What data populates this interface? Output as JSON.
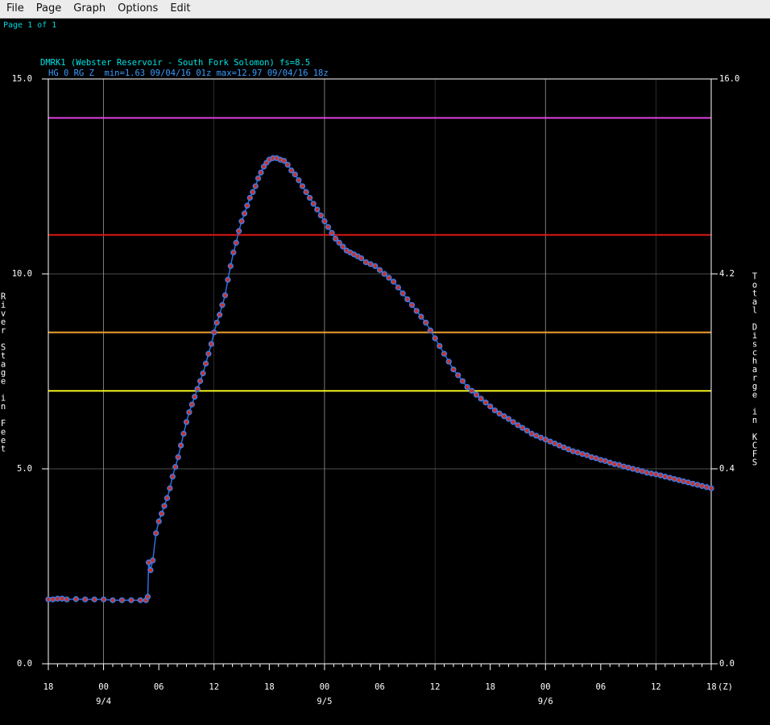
{
  "menu": {
    "items": [
      "File",
      "Page",
      "Graph",
      "Options",
      "Edit"
    ]
  },
  "page_indicator": "Page 1 of 1",
  "colors": {
    "background": "#000000",
    "grid": "#9a9a9a",
    "axis_text": "#ffffff",
    "title_text": "#00e5e5",
    "subtitle_text": "#3a9cff",
    "series_line": "#2f6fdc",
    "series_marker_fill": "#c8322c",
    "series_marker_stroke": "#3a7ff0"
  },
  "chart_data": {
    "type": "line",
    "title": "DMRK1 (Webster Reservoir - South Fork Solomon) fs=8.5",
    "subtitle": "HG 0 RG Z  min=1.63 09/04/16 01z max=12.97 09/04/16 18z",
    "ylabel": "River Stage in Feet",
    "y2label": "Total Discharge in KCFS",
    "ylim": [
      0,
      15
    ],
    "yticks": [
      "0.0",
      "5.0",
      "10.0",
      "15.0"
    ],
    "y2ticks": [
      "0.0",
      "0.4",
      "4.2",
      "16.0"
    ],
    "xlim": [
      0,
      72
    ],
    "x_unit": "hours after 09/03 18Z",
    "xticks": [
      {
        "x": 0,
        "label": "18",
        "date": ""
      },
      {
        "x": 6,
        "label": "00",
        "date": "9/4"
      },
      {
        "x": 12,
        "label": "06",
        "date": ""
      },
      {
        "x": 18,
        "label": "12",
        "date": ""
      },
      {
        "x": 24,
        "label": "18",
        "date": ""
      },
      {
        "x": 30,
        "label": "00",
        "date": "9/5"
      },
      {
        "x": 36,
        "label": "06",
        "date": ""
      },
      {
        "x": 42,
        "label": "12",
        "date": ""
      },
      {
        "x": 48,
        "label": "18",
        "date": ""
      },
      {
        "x": 54,
        "label": "00",
        "date": "9/6"
      },
      {
        "x": 60,
        "label": "06",
        "date": ""
      },
      {
        "x": 66,
        "label": "12",
        "date": ""
      },
      {
        "x": 72,
        "label": "18",
        "date": ""
      }
    ],
    "x_suffix": "(Z)",
    "grid": true,
    "thresholds": [
      {
        "value": 14.0,
        "color": "#e040e0"
      },
      {
        "value": 11.0,
        "color": "#e01818"
      },
      {
        "value": 8.5,
        "color": "#f0a030"
      },
      {
        "value": 7.0,
        "color": "#f0f020"
      }
    ],
    "series": [
      {
        "points": [
          [
            0,
            1.65
          ],
          [
            0.5,
            1.65
          ],
          [
            1,
            1.67
          ],
          [
            1.5,
            1.67
          ],
          [
            2,
            1.65
          ],
          [
            3,
            1.66
          ],
          [
            4,
            1.65
          ],
          [
            5,
            1.65
          ],
          [
            6,
            1.65
          ],
          [
            7,
            1.63
          ],
          [
            8,
            1.63
          ],
          [
            9,
            1.63
          ],
          [
            10,
            1.63
          ],
          [
            10.6,
            1.63
          ],
          [
            10.8,
            1.72
          ],
          [
            10.9,
            2.6
          ],
          [
            11.1,
            2.4
          ],
          [
            11.35,
            2.65
          ],
          [
            11.7,
            3.35
          ],
          [
            12.0,
            3.65
          ],
          [
            12.3,
            3.85
          ],
          [
            12.6,
            4.05
          ],
          [
            12.9,
            4.25
          ],
          [
            13.2,
            4.5
          ],
          [
            13.5,
            4.8
          ],
          [
            13.8,
            5.05
          ],
          [
            14.1,
            5.3
          ],
          [
            14.4,
            5.6
          ],
          [
            14.7,
            5.9
          ],
          [
            15.0,
            6.2
          ],
          [
            15.3,
            6.45
          ],
          [
            15.6,
            6.65
          ],
          [
            15.9,
            6.85
          ],
          [
            16.2,
            7.05
          ],
          [
            16.5,
            7.25
          ],
          [
            16.8,
            7.45
          ],
          [
            17.1,
            7.7
          ],
          [
            17.4,
            7.95
          ],
          [
            17.7,
            8.2
          ],
          [
            18.0,
            8.5
          ],
          [
            18.3,
            8.75
          ],
          [
            18.6,
            8.95
          ],
          [
            18.9,
            9.2
          ],
          [
            19.2,
            9.45
          ],
          [
            19.5,
            9.85
          ],
          [
            19.8,
            10.2
          ],
          [
            20.1,
            10.55
          ],
          [
            20.4,
            10.8
          ],
          [
            20.7,
            11.1
          ],
          [
            21.0,
            11.35
          ],
          [
            21.3,
            11.55
          ],
          [
            21.6,
            11.75
          ],
          [
            21.9,
            11.95
          ],
          [
            22.2,
            12.1
          ],
          [
            22.5,
            12.25
          ],
          [
            22.8,
            12.45
          ],
          [
            23.1,
            12.6
          ],
          [
            23.4,
            12.75
          ],
          [
            23.7,
            12.85
          ],
          [
            24.0,
            12.93
          ],
          [
            24.4,
            12.97
          ],
          [
            24.8,
            12.97
          ],
          [
            25.2,
            12.93
          ],
          [
            25.6,
            12.9
          ],
          [
            26.0,
            12.8
          ],
          [
            26.4,
            12.65
          ],
          [
            26.8,
            12.55
          ],
          [
            27.2,
            12.4
          ],
          [
            27.6,
            12.25
          ],
          [
            28.0,
            12.1
          ],
          [
            28.4,
            11.95
          ],
          [
            28.8,
            11.8
          ],
          [
            29.2,
            11.65
          ],
          [
            29.6,
            11.5
          ],
          [
            30.0,
            11.35
          ],
          [
            30.4,
            11.2
          ],
          [
            30.8,
            11.05
          ],
          [
            31.2,
            10.9
          ],
          [
            31.6,
            10.8
          ],
          [
            32.0,
            10.7
          ],
          [
            32.4,
            10.6
          ],
          [
            32.8,
            10.55
          ],
          [
            33.2,
            10.5
          ],
          [
            33.6,
            10.45
          ],
          [
            34.0,
            10.4
          ],
          [
            34.5,
            10.3
          ],
          [
            35.0,
            10.25
          ],
          [
            35.5,
            10.2
          ],
          [
            36.0,
            10.1
          ],
          [
            36.5,
            10.0
          ],
          [
            37.0,
            9.9
          ],
          [
            37.5,
            9.8
          ],
          [
            38.0,
            9.65
          ],
          [
            38.5,
            9.5
          ],
          [
            39.0,
            9.35
          ],
          [
            39.5,
            9.2
          ],
          [
            40.0,
            9.05
          ],
          [
            40.5,
            8.9
          ],
          [
            41.0,
            8.75
          ],
          [
            41.5,
            8.55
          ],
          [
            42.0,
            8.35
          ],
          [
            42.5,
            8.15
          ],
          [
            43.0,
            7.95
          ],
          [
            43.5,
            7.75
          ],
          [
            44.0,
            7.55
          ],
          [
            44.5,
            7.4
          ],
          [
            45.0,
            7.25
          ],
          [
            45.5,
            7.1
          ],
          [
            46.0,
            7.0
          ],
          [
            46.5,
            6.9
          ],
          [
            47.0,
            6.8
          ],
          [
            47.5,
            6.7
          ],
          [
            48.0,
            6.6
          ],
          [
            48.5,
            6.5
          ],
          [
            49.0,
            6.42
          ],
          [
            49.5,
            6.35
          ],
          [
            50.0,
            6.28
          ],
          [
            50.5,
            6.2
          ],
          [
            51.0,
            6.12
          ],
          [
            51.5,
            6.05
          ],
          [
            52.0,
            5.98
          ],
          [
            52.5,
            5.9
          ],
          [
            53.0,
            5.85
          ],
          [
            53.5,
            5.8
          ],
          [
            54.0,
            5.75
          ],
          [
            54.5,
            5.7
          ],
          [
            55.0,
            5.65
          ],
          [
            55.5,
            5.6
          ],
          [
            56.0,
            5.55
          ],
          [
            56.5,
            5.5
          ],
          [
            57.0,
            5.45
          ],
          [
            57.5,
            5.42
          ],
          [
            58.0,
            5.38
          ],
          [
            58.5,
            5.35
          ],
          [
            59.0,
            5.3
          ],
          [
            59.5,
            5.27
          ],
          [
            60.0,
            5.23
          ],
          [
            60.5,
            5.2
          ],
          [
            61.0,
            5.16
          ],
          [
            61.5,
            5.12
          ],
          [
            62.0,
            5.1
          ],
          [
            62.5,
            5.06
          ],
          [
            63.0,
            5.03
          ],
          [
            63.5,
            5.0
          ],
          [
            64.0,
            4.97
          ],
          [
            64.5,
            4.94
          ],
          [
            65.0,
            4.9
          ],
          [
            65.5,
            4.88
          ],
          [
            66.0,
            4.86
          ],
          [
            66.5,
            4.83
          ],
          [
            67.0,
            4.8
          ],
          [
            67.5,
            4.77
          ],
          [
            68.0,
            4.74
          ],
          [
            68.5,
            4.71
          ],
          [
            69.0,
            4.68
          ],
          [
            69.5,
            4.65
          ],
          [
            70.0,
            4.62
          ],
          [
            70.5,
            4.59
          ],
          [
            71.0,
            4.56
          ],
          [
            71.5,
            4.53
          ],
          [
            72.0,
            4.5
          ]
        ]
      }
    ]
  }
}
